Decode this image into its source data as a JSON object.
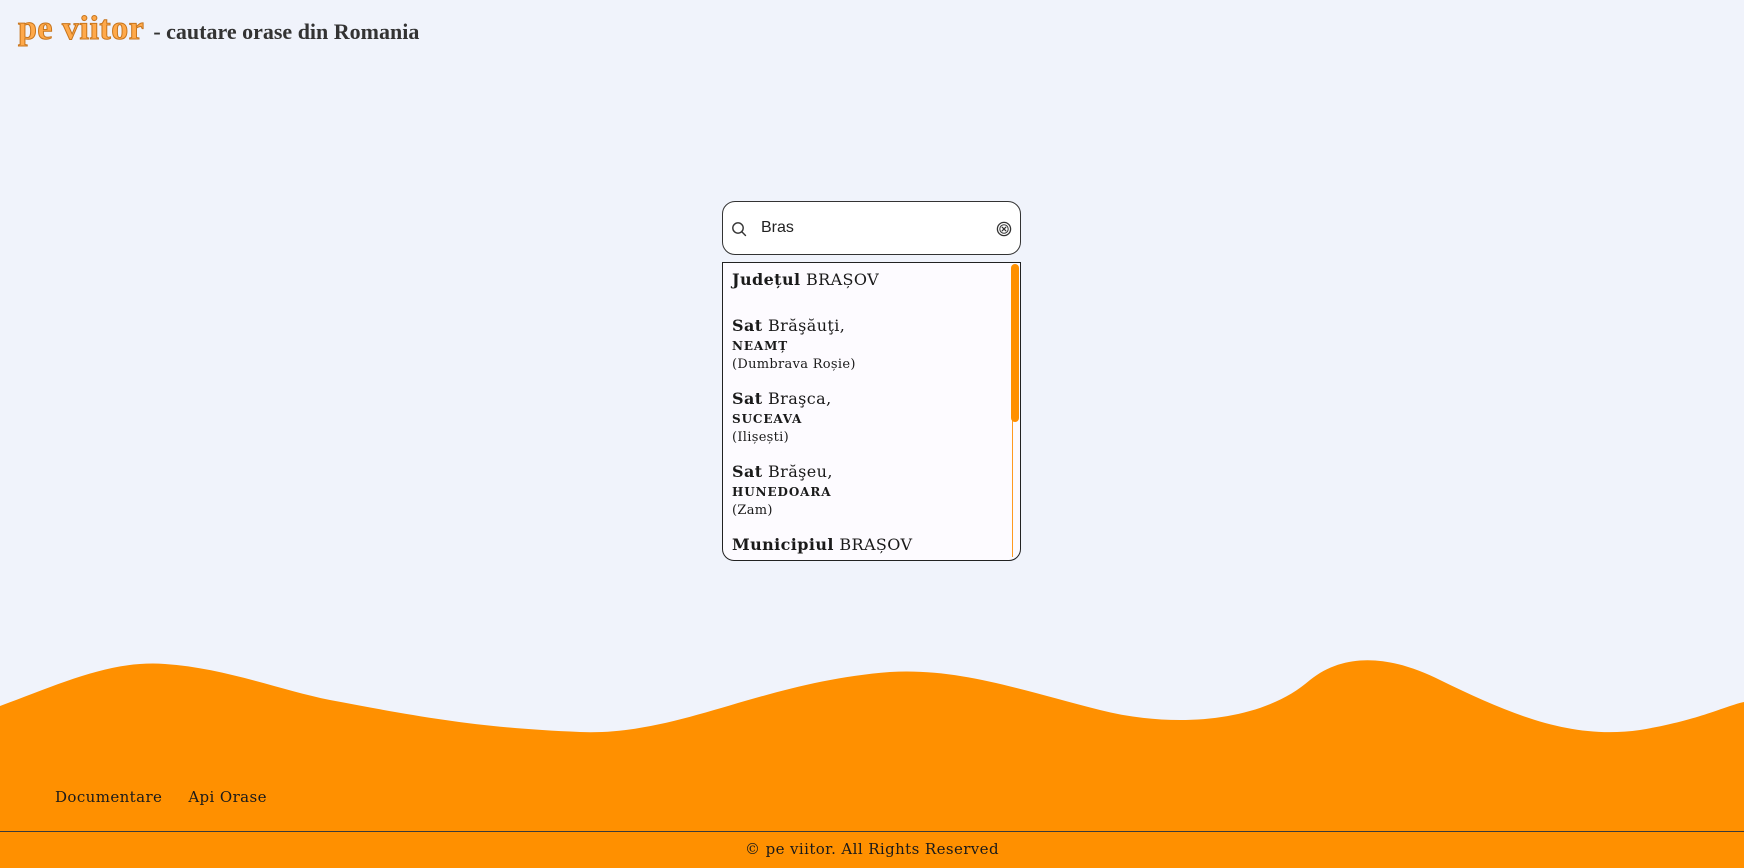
{
  "header": {
    "logo": "pe viitor",
    "subtitle": "- cautare orase din Romania"
  },
  "search": {
    "value": "Bras",
    "placeholder": ""
  },
  "results": [
    {
      "type": "Județul",
      "name": "BRAȘOV",
      "county": "",
      "commune": ""
    },
    {
      "type": "Sat",
      "name": "Brăşăuţi,",
      "county": "NEAMȚ",
      "commune": "(Dumbrava Roșie)"
    },
    {
      "type": "Sat",
      "name": "Braşca,",
      "county": "SUCEAVA",
      "commune": "(Ilișești)"
    },
    {
      "type": "Sat",
      "name": "Brăşeu,",
      "county": "HUNEDOARA",
      "commune": "(Zam)"
    },
    {
      "type": "Municipiul",
      "name": "BRAȘOV",
      "county": "",
      "commune": ""
    }
  ],
  "footer": {
    "links": [
      "Documentare",
      "Api Orase"
    ],
    "copyright": "© pe viitor. All Rights Reserved"
  },
  "colors": {
    "accent": "#ff9000",
    "background": "#f0f3fb",
    "logo": "#ffa94a"
  }
}
